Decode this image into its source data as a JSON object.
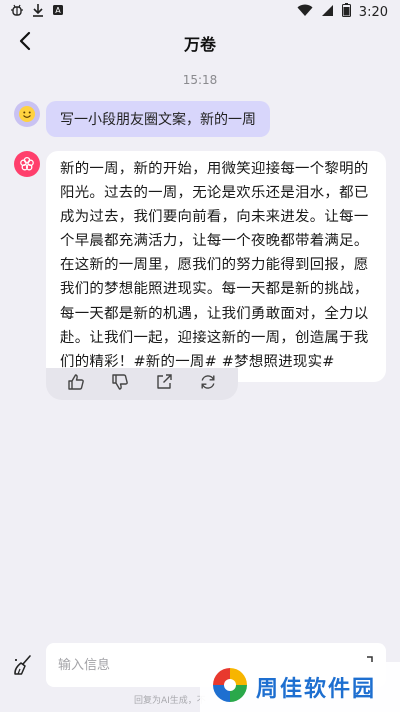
{
  "status_bar": {
    "time": "3:20",
    "left_icons": [
      "bug-icon",
      "download-icon",
      "sim-icon"
    ],
    "right_icons": [
      "wifi-icon",
      "signal-icon",
      "battery-icon"
    ]
  },
  "nav": {
    "title": "万卷",
    "back_icon": "chevron-left-icon"
  },
  "chat": {
    "timestamp": "15:18",
    "user_message": "写一小段朋友圈文案，新的一周",
    "ai_message": "新的一周，新的开始，用微笑迎接每一个黎明的阳光。过去的一周，无论是欢乐还是泪水，都已成为过去，我们要向前看，向未来进发。让每一个早晨都充满活力，让每一个夜晚都带着满足。在这新的一周里，愿我们的努力能得到回报，愿我们的梦想能照进现实。每一天都是新的挑战，每一天都是新的机遇，让我们勇敢面对，全力以赴。让我们一起，迎接这新的一周，创造属于我们的精彩！#新的一周# #梦想照进现实#",
    "actions": [
      "thumbs-up-icon",
      "thumbs-down-icon",
      "share-icon",
      "regenerate-icon"
    ]
  },
  "input": {
    "placeholder": "输入信息",
    "disclaimer": "回复为AI生成，不"
  },
  "watermark": {
    "text": "周佳软件园"
  },
  "colors": {
    "background": "#f0eff5",
    "user_bubble": "#d8d6fb",
    "ai_bubble": "#ffffff",
    "ai_avatar": "#ff3f6c",
    "user_avatar": "#c9c2f2"
  }
}
